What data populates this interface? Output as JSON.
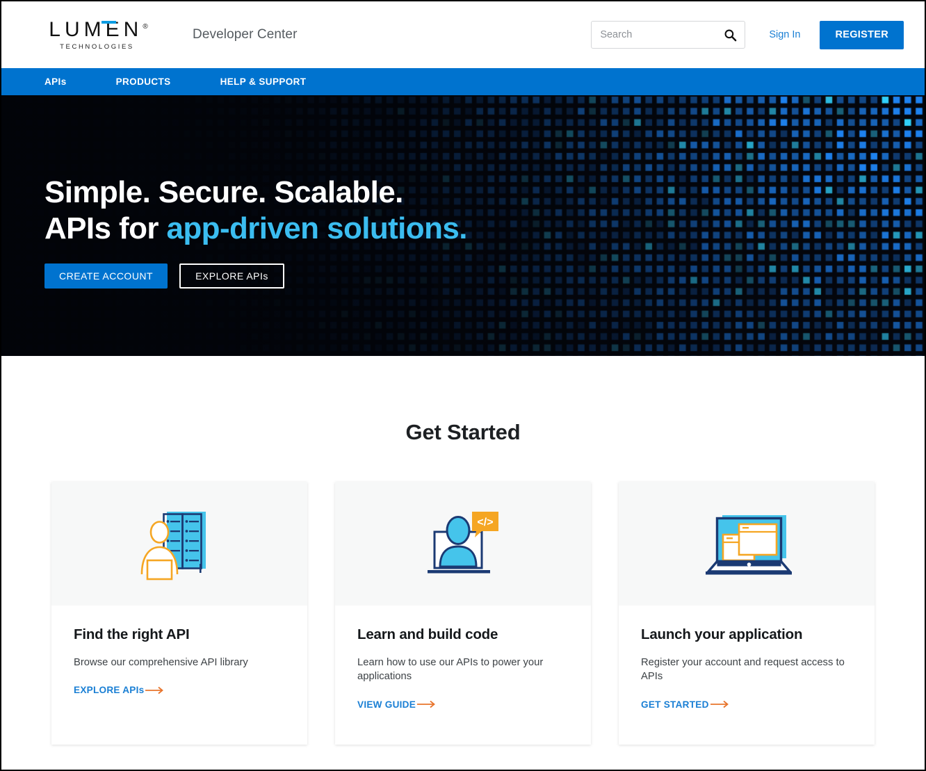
{
  "header": {
    "logo_wordmark": "LUMEN",
    "logo_reg": "®",
    "logo_sub": "TECHNOLOGIES",
    "site_title": "Developer Center",
    "search_placeholder": "Search",
    "search_value": "",
    "search_icon": "search-icon",
    "sign_in_label": "Sign In",
    "register_label": "REGISTER"
  },
  "nav": {
    "items": [
      {
        "label": "APIs"
      },
      {
        "label": "PRODUCTS"
      },
      {
        "label": "HELP & SUPPORT"
      }
    ]
  },
  "hero": {
    "line1": "Simple. Secure. Scalable.",
    "line2_prefix": "APIs for ",
    "line2_accent": "app-driven solutions.",
    "primary_button": "CREATE ACCOUNT",
    "secondary_button": "EXPLORE APIs"
  },
  "get_started": {
    "title": "Get Started",
    "cards": [
      {
        "icon": "person-at-api-library-icon",
        "title": "Find the right API",
        "description": "Browse our comprehensive API library",
        "link_label": "EXPLORE APIs"
      },
      {
        "icon": "person-laptop-code-bubble-icon",
        "title": "Learn and build code",
        "description": "Learn how to use our APIs to power your applications",
        "link_label": "VIEW GUIDE"
      },
      {
        "icon": "laptop-windows-icon",
        "title": "Launch your application",
        "description": "Register your account and request access to APIs",
        "link_label": "GET STARTED"
      }
    ]
  },
  "colors": {
    "brand_blue": "#0073CF",
    "link_blue": "#1A7FD4",
    "accent_cyan": "#3BBDF0",
    "arrow_orange": "#E8742C",
    "icon_orange": "#F5A623",
    "icon_navy": "#1B3A73",
    "icon_cyan": "#45C4EB",
    "hero_bg": "#05070D",
    "panel_gray": "#F7F8F8"
  }
}
